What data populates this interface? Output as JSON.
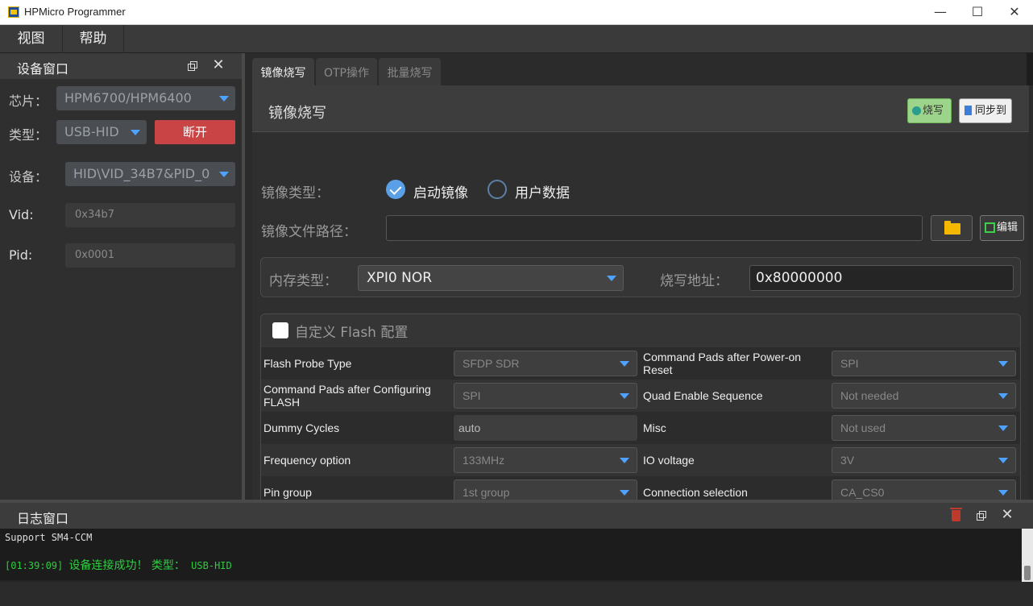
{
  "window": {
    "title": "HPMicro Programmer",
    "minimize": "—",
    "maximize": "☐",
    "close": "✕"
  },
  "menu": {
    "view": "视图",
    "help": "帮助"
  },
  "device_panel": {
    "title": "设备窗口",
    "close": "✕",
    "chip_label": "芯片：",
    "chip_value": "HPM6700/HPM6400",
    "type_label": "类型：",
    "type_value": "USB-HID",
    "disconnect": "断开",
    "device_label": "设备：",
    "device_value": "HID\\VID_34B7&PID_0",
    "vid_label": "Vid:",
    "vid_value": "0x34b7",
    "pid_label": "Pid:",
    "pid_value": "0x0001"
  },
  "tabs": [
    "镜像烧写",
    "OTP操作",
    "批量烧写"
  ],
  "image_burn": {
    "title": "镜像烧写",
    "burn_button": "烧写",
    "sync_button": "同步到",
    "image_type_label": "镜像类型：",
    "radio_boot": "启动镜像",
    "radio_user": "用户数据",
    "selected_type": "启动镜像",
    "path_label": "镜像文件路径：",
    "path_value": "",
    "edit_button": "编辑",
    "mem_type_label": "内存类型：",
    "mem_type_value": "XPI0 NOR",
    "addr_label": "烧写地址：",
    "addr_value": "0x80000000"
  },
  "flash_config": {
    "checkbox_label": "自定义 Flash 配置",
    "checked": false,
    "rows": [
      {
        "left_name": "Flash Probe Type",
        "left_value": "SFDP SDR",
        "right_name": "Command Pads after Power-on Reset",
        "right_value": "SPI"
      },
      {
        "left_name": "Command Pads after Configuring FLASH",
        "left_value": "SPI",
        "right_name": "Quad Enable Sequence",
        "right_value": "Not needed"
      },
      {
        "left_name": "Dummy Cycles",
        "left_value": "auto",
        "right_name": "Misc",
        "right_value": "Not used"
      },
      {
        "left_name": "Frequency option",
        "left_value": "133MHz",
        "right_name": "IO voltage",
        "right_value": "3V"
      },
      {
        "left_name": "Pin group",
        "left_value": "1st group",
        "right_name": "Connection selection",
        "right_value": "CA_CS0"
      }
    ]
  },
  "log": {
    "title": "日志窗口",
    "close": "✕",
    "line1": "Support SM4-CCM",
    "line2_time": "[01:39:09]",
    "line2_msg": "设备连接成功！ 类型：",
    "line2_type": "USB-HID"
  },
  "colors": {
    "accent": "#4da3ff",
    "burn_green": "#9bd48a",
    "disconnect_red": "#c94444",
    "log_green": "#2ecc40"
  }
}
